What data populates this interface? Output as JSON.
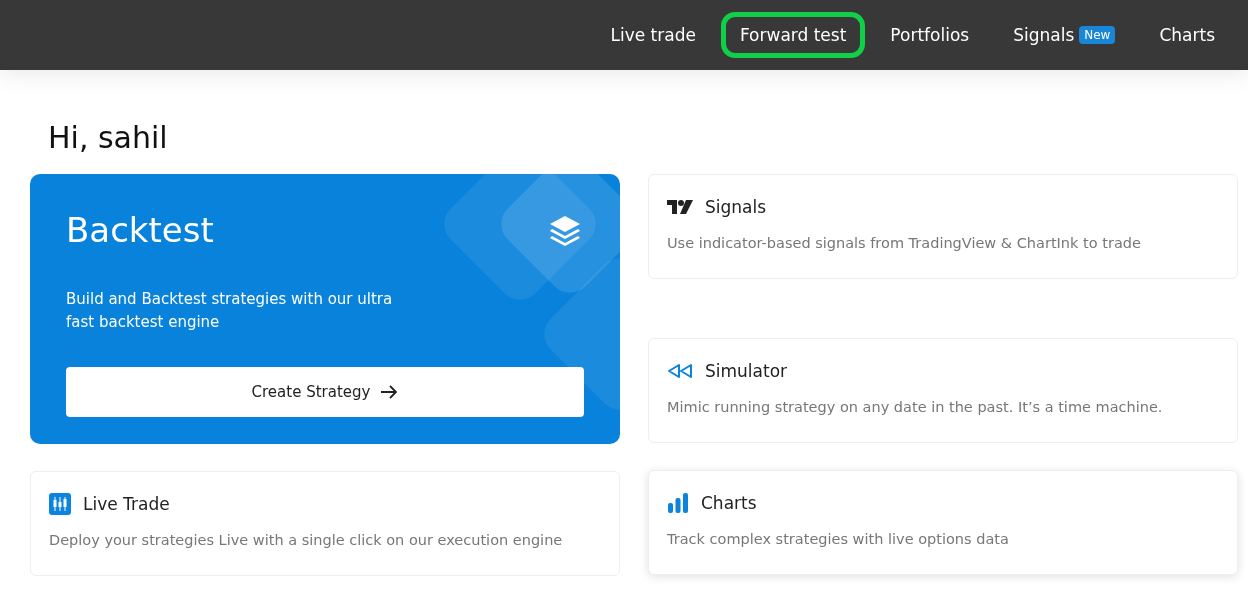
{
  "nav": [
    {
      "label": "Live trade",
      "highlighted": false
    },
    {
      "label": "Forward test",
      "highlighted": true
    },
    {
      "label": "Portfolios",
      "highlighted": false
    },
    {
      "label": "Signals",
      "highlighted": false,
      "badge": "New"
    },
    {
      "label": "Charts",
      "highlighted": false
    }
  ],
  "greeting": "Hi, sahil",
  "hero": {
    "title": "Backtest",
    "description": "Build and Backtest strategies with our ultra fast backtest engine",
    "button": "Create Strategy"
  },
  "left_cards": [
    {
      "kind": "candles",
      "title": "Live Trade",
      "description": "Deploy your strategies Live with a single click on our execution engine",
      "elevated": false
    }
  ],
  "right_cards": [
    {
      "kind": "logo",
      "title": "Signals",
      "description": "Use indicator-based signals from TradingView & ChartInk to trade",
      "elevated": false
    },
    {
      "kind": "rewind",
      "title": "Simulator",
      "description": "Mimic running strategy on any date in the past. It’s a time machine.",
      "elevated": false
    },
    {
      "kind": "bars",
      "title": "Charts",
      "description": "Track complex strategies with live options data",
      "elevated": true
    }
  ]
}
